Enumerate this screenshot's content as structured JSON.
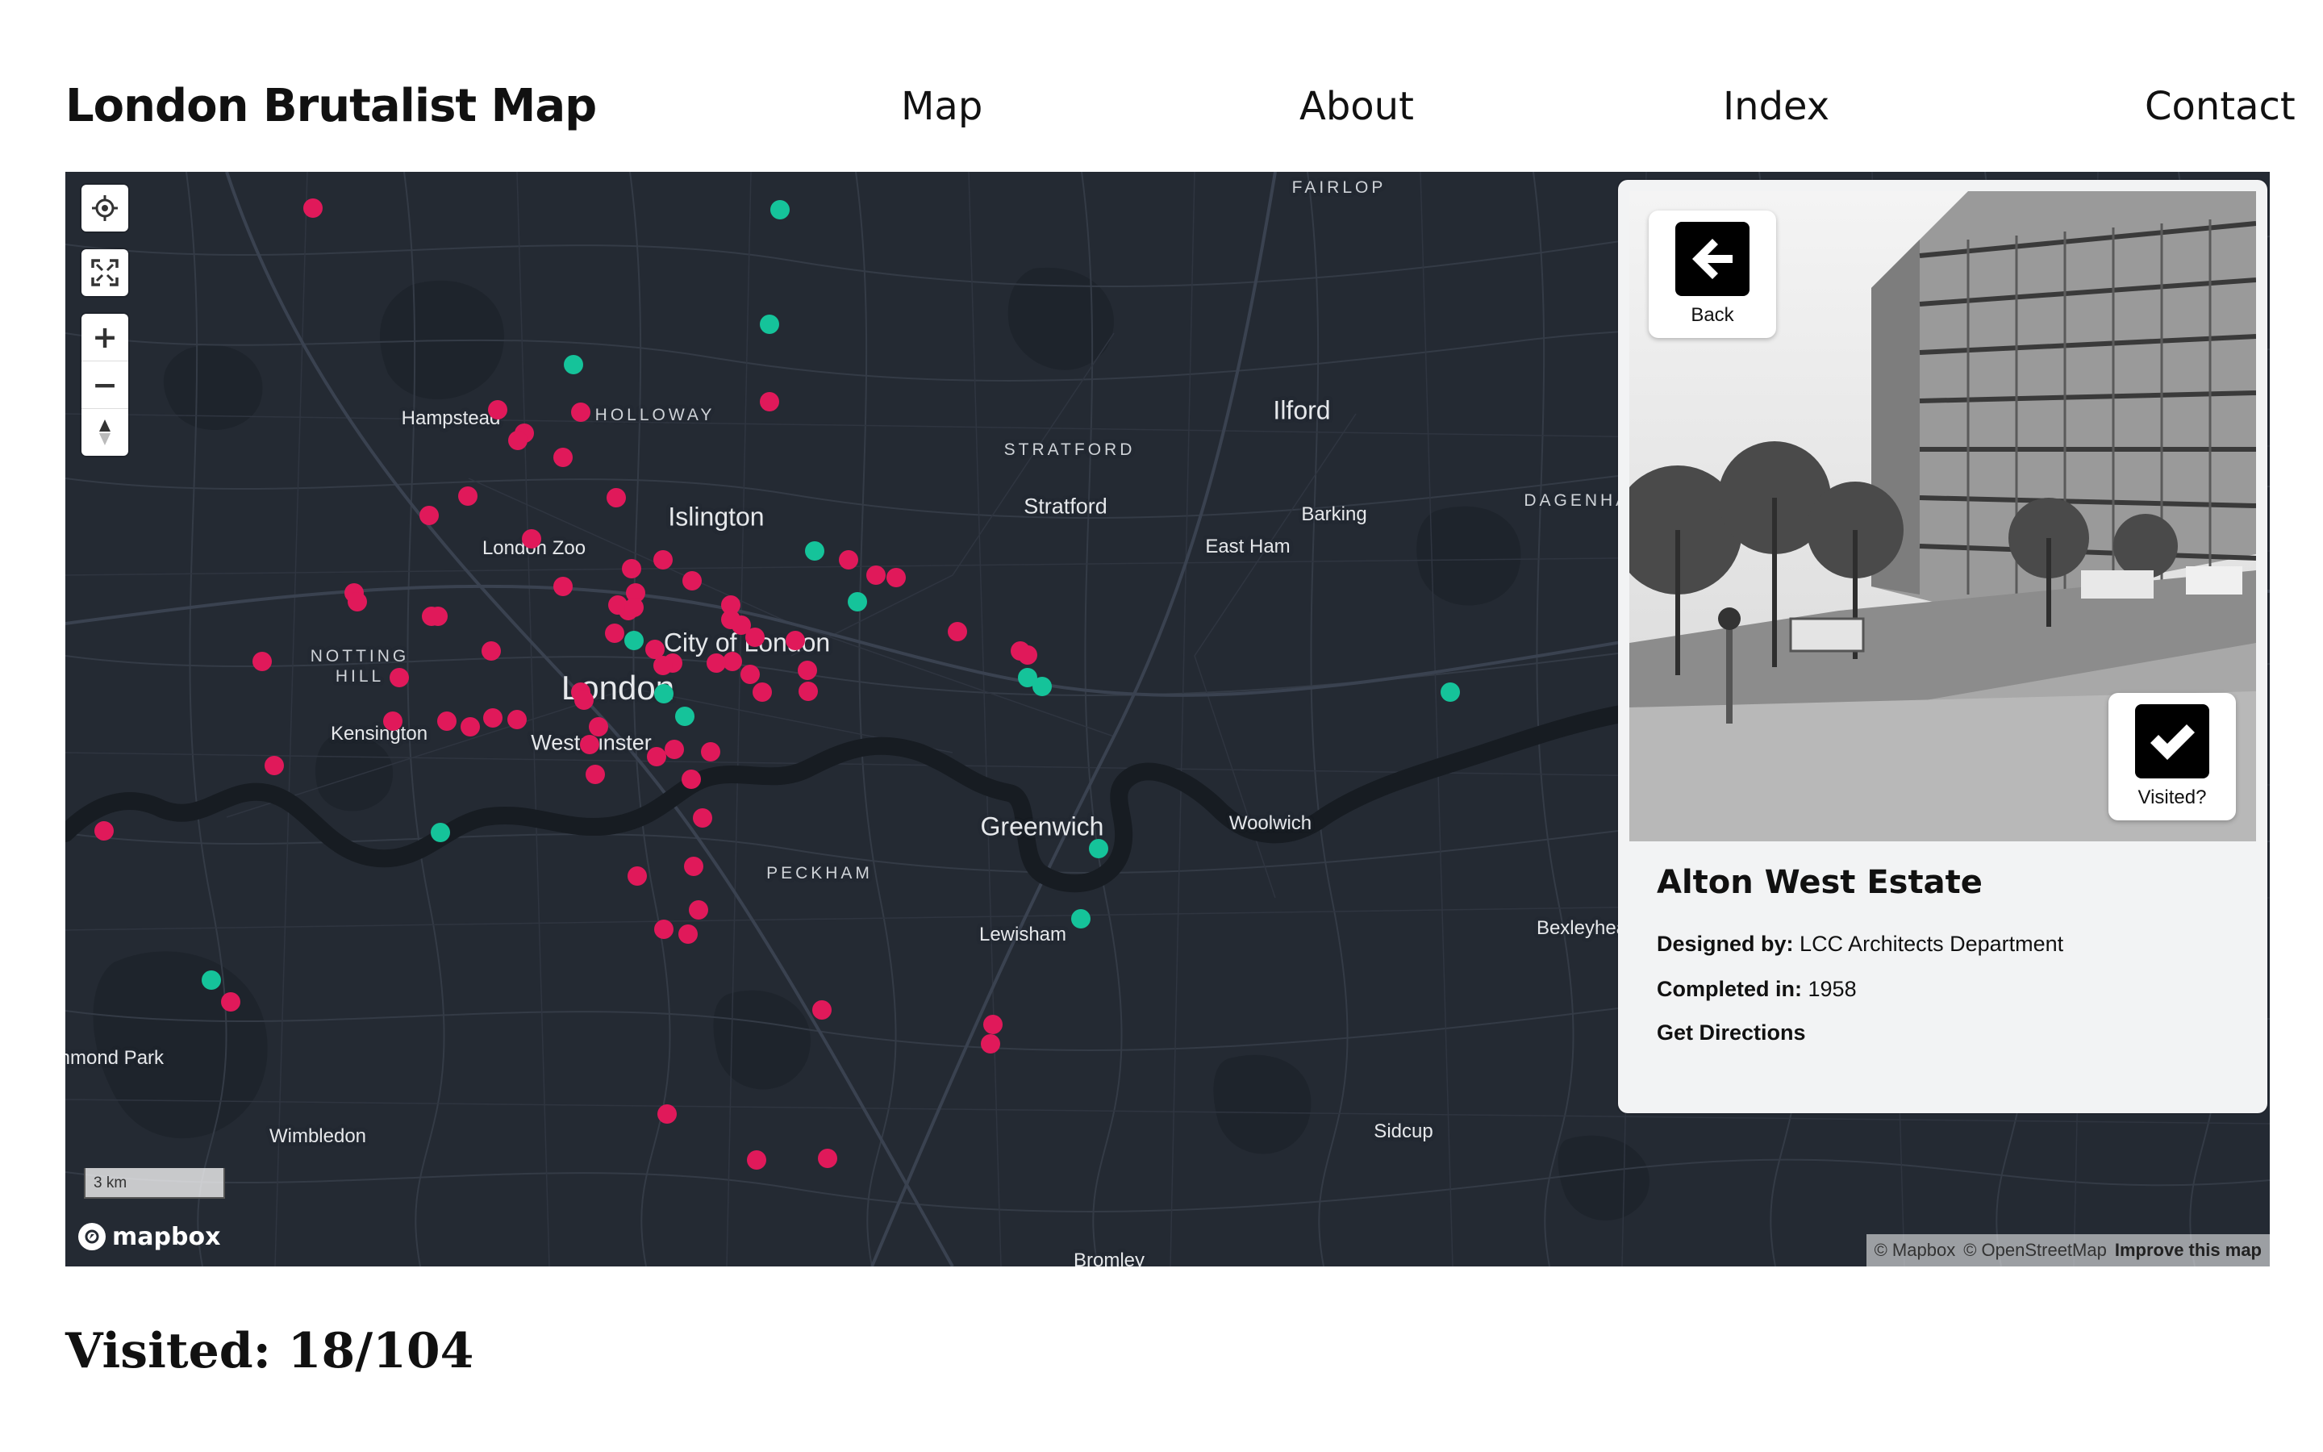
{
  "header": {
    "title": "London Brutalist Map",
    "nav": [
      "Map",
      "About",
      "Index",
      "Contact"
    ]
  },
  "map": {
    "places": [
      {
        "name": "FAIRLOP",
        "size": "caps"
      },
      {
        "name": "Hampstead",
        "size": "small"
      },
      {
        "name": "HOLLOWAY",
        "size": "caps"
      },
      {
        "name": "Ilford",
        "size": "big"
      },
      {
        "name": "STRATFORD",
        "size": "caps"
      },
      {
        "name": "Stratford",
        "size": "med"
      },
      {
        "name": "DAGENHAM",
        "size": "caps"
      },
      {
        "name": "Barking",
        "size": "small"
      },
      {
        "name": "Islington",
        "size": "big"
      },
      {
        "name": "London Zoo",
        "size": "small"
      },
      {
        "name": "East Ham",
        "size": "small"
      },
      {
        "name": "NOTTING",
        "size": "caps"
      },
      {
        "name": "HILL",
        "size": "caps"
      },
      {
        "name": "City of London",
        "size": "big"
      },
      {
        "name": "London",
        "size": "big"
      },
      {
        "name": "Kensington",
        "size": "small"
      },
      {
        "name": "Westminster",
        "size": "med"
      },
      {
        "name": "Greenwich",
        "size": "big"
      },
      {
        "name": "Woolwich",
        "size": "small"
      },
      {
        "name": "PECKHAM",
        "size": "caps"
      },
      {
        "name": "Lewisham",
        "size": "small"
      },
      {
        "name": "Bexleyheath",
        "size": "small"
      },
      {
        "name": "Richmond Park",
        "size": "small"
      },
      {
        "name": "Wimbledon",
        "size": "small"
      },
      {
        "name": "Sidcup",
        "size": "small"
      },
      {
        "name": "Bromley",
        "size": "small"
      }
    ],
    "marker_colors": {
      "unvisited": "#e0195a",
      "visited": "#15c39a"
    },
    "controls": {
      "locate_icon": "locate-icon",
      "fullscreen_icon": "fullscreen-icon",
      "zoom_in": "+",
      "zoom_out": "−",
      "compass_icon": "compass-icon"
    },
    "scale_label": "3 km",
    "logo_text": "mapbox",
    "attribution": {
      "mapbox": "© Mapbox",
      "osm": "© OpenStreetMap",
      "improve": "Improve this map"
    }
  },
  "panel": {
    "back_label": "Back",
    "back_icon": "arrow-left-icon",
    "visited_label": "Visited?",
    "visited_icon": "checkmark-icon",
    "building": {
      "name": "Alton West Estate",
      "designed_by_label": "Designed by:",
      "designed_by": "LCC Architects Department",
      "completed_label": "Completed in:",
      "completed": "1958",
      "directions_label": "Get Directions"
    }
  },
  "footer": {
    "visited_text": "Visited: 18/104"
  }
}
